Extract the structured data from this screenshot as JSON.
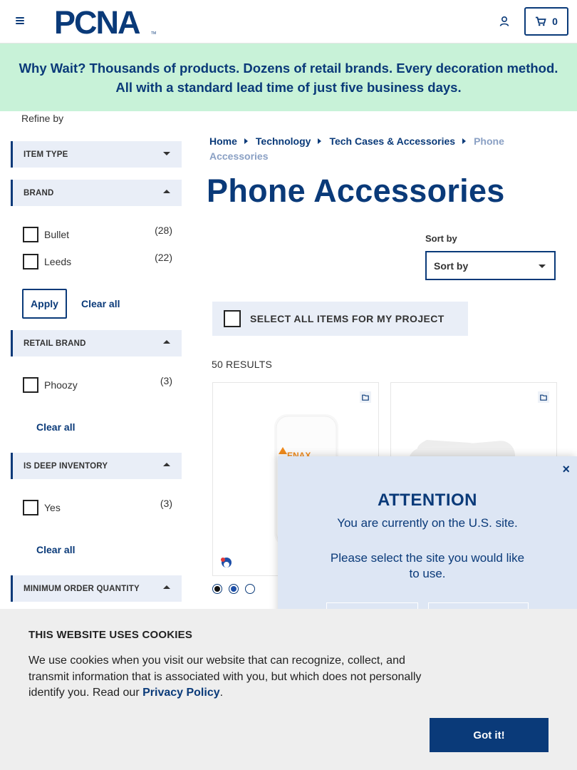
{
  "header": {
    "logo_text": "PCNA",
    "logo_tm": "TM",
    "cart_count": "0"
  },
  "promo": {
    "text": "Why Wait? Thousands of products. Dozens of retail brands. Every decoration method. All with a standard lead time of just five business days."
  },
  "sidebar": {
    "refine_label": "Refine by",
    "facets": {
      "item_type": {
        "label": "ITEM TYPE",
        "expanded": false
      },
      "brand": {
        "label": "BRAND",
        "expanded": true,
        "options": [
          {
            "name": "Bullet",
            "count": "(28)"
          },
          {
            "name": "Leeds",
            "count": "(22)"
          }
        ],
        "apply_label": "Apply",
        "clear_label": "Clear all"
      },
      "retail_brand": {
        "label": "RETAIL BRAND",
        "expanded": true,
        "options": [
          {
            "name": "Phoozy",
            "count": "(3)"
          }
        ],
        "clear_label": "Clear all"
      },
      "deep_inventory": {
        "label": "IS DEEP INVENTORY",
        "expanded": true,
        "options": [
          {
            "name": "Yes",
            "count": "(3)"
          }
        ],
        "clear_label": "Clear all"
      },
      "min_qty": {
        "label": "MINIMUM ORDER QUANTITY",
        "expanded": true
      }
    }
  },
  "breadcrumb": {
    "items": [
      "Home",
      "Technology",
      "Tech Cases & Accessories"
    ],
    "current": "Phone Accessories"
  },
  "page_title": "Phone Accessories",
  "sort": {
    "label": "Sort by",
    "selected": "Sort by"
  },
  "select_all": {
    "label": "SELECT ALL ITEMS FOR MY PROJECT"
  },
  "results": {
    "text": "50 RESULTS"
  },
  "products": [
    {
      "imprint_text": "ENAX",
      "swatches": [
        "#111111",
        "#1d4fa8",
        "#ffffff"
      ]
    },
    {
      "imprint_text": ""
    }
  ],
  "colors": {
    "brand_blue": "#0a3a79",
    "promo_bg": "#c8f2d8",
    "facet_bg": "#e9eef7",
    "modal_bg": "#dde6f4",
    "cookie_bg": "#eeeeee",
    "imprint_orange": "#f08a1c"
  },
  "attention_modal": {
    "close": "×",
    "title": "ATTENTION",
    "line1": "You are currently on the U.S. site.",
    "line2": "Please select the site you would like to use."
  },
  "cookie_banner": {
    "title": "THIS WEBSITE USES COOKIES",
    "body": "We use cookies when you visit our website that can recognize, collect, and transmit information that is associated with you, but which does not personally identify you. Read our ",
    "link": "Privacy Policy",
    "end": ".",
    "button": "Got it!"
  }
}
